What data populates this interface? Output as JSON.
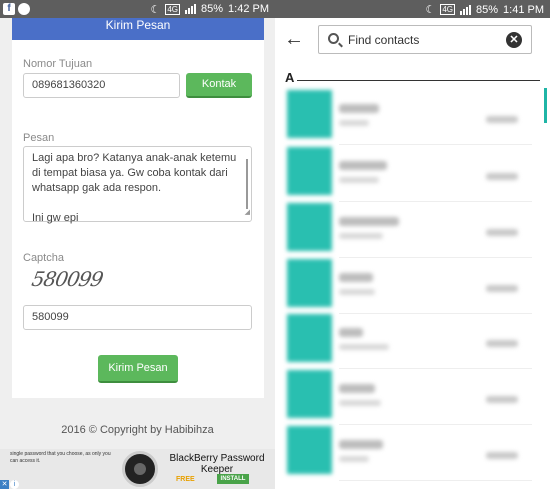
{
  "left_phone": {
    "status_bar": {
      "battery": "85%",
      "time": "1:42 PM",
      "network": "4G"
    },
    "form": {
      "header_title": "Kirim Pesan",
      "nomor_label": "Nomor Tujuan",
      "nomor_value": "089681360320",
      "kontak_button": "Kontak",
      "pesan_label": "Pesan",
      "pesan_lines": [
        "Lagi apa bro? Katanya anak-anak ketemu",
        "di tempat biasa ya. Gw coba kontak dari",
        "whatsapp gak ada respon.",
        "",
        "Ini gw epi"
      ],
      "captcha_label": "Captcha",
      "captcha_image_text": "580099",
      "captcha_value": "580099",
      "submit_button": "Kirim Pesan"
    },
    "footer": {
      "copyright": "2016 © Copyright by Habibihza"
    },
    "ad": {
      "small_text": "single password that you choose, as only you can access it.",
      "title": "BlackBerry Password Keeper",
      "price": "FREE",
      "install": "INSTALL",
      "close_glyph": "✕",
      "info_glyph": "i"
    }
  },
  "right_phone": {
    "status_bar": {
      "battery": "85%",
      "time": "1:41 PM",
      "network": "4G"
    },
    "search": {
      "placeholder": "Find contacts"
    },
    "section_letter": "A",
    "accent_color": "#29bfb0"
  }
}
